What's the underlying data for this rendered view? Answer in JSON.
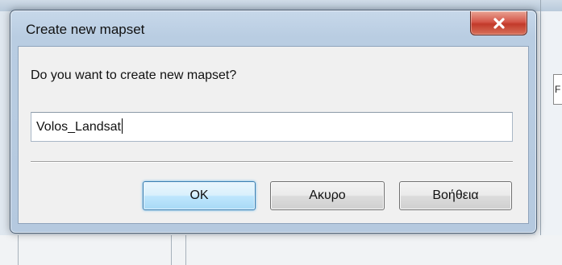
{
  "dialog": {
    "title": "Create new mapset",
    "close_icon": "close-icon",
    "prompt": "Do you want to create new mapset?",
    "input_value": "Volos_Landsat",
    "buttons": {
      "ok": "OK",
      "cancel": "Ακυρο",
      "help": "Βοήθεια"
    }
  },
  "background": {
    "partial_char": "F"
  },
  "colors": {
    "close_button": "#c8463a",
    "default_button_border": "#3c7fb1"
  }
}
